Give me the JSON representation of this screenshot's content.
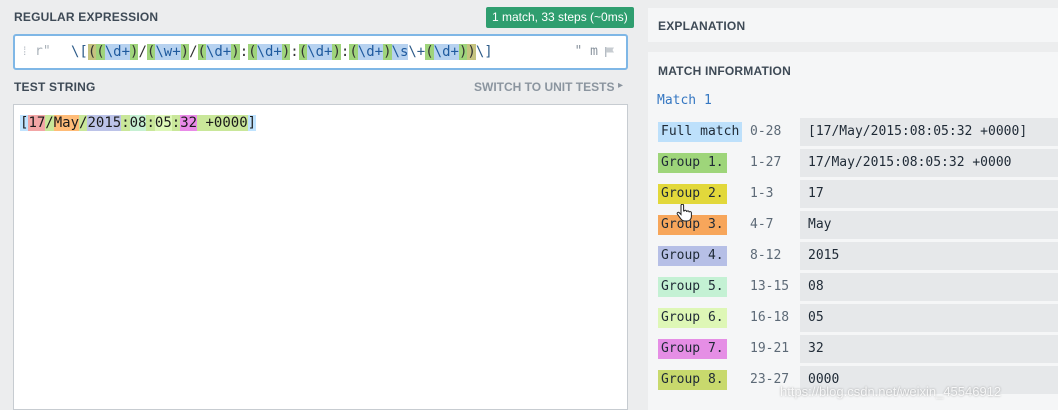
{
  "regex_section": {
    "label": "REGULAR EXPRESSION",
    "badge": "1 match, 33 steps (~0ms)",
    "prefix": "r\"",
    "pattern": "\\[((\\d+)/(\\w+)/(\\d+):(\\d+):(\\d+):(\\d+)\\s\\+(\\d+))\\]",
    "suffix": "\"",
    "flags": "m"
  },
  "test_section": {
    "label": "TEST STRING",
    "switch_label": "SWITCH TO UNIT TESTS",
    "text": "[17/May/2015:08:05:32 +0000]"
  },
  "explanation": {
    "label": "EXPLANATION"
  },
  "match_info": {
    "label": "MATCH INFORMATION",
    "match_label": "Match 1",
    "rows": [
      {
        "name": "Full match",
        "range": "0-28",
        "value": "[17/May/2015:08:05:32 +0000]",
        "color": "#bde0fb"
      },
      {
        "name": "Group 1.",
        "range": "1-27",
        "value": "17/May/2015:08:05:32 +0000",
        "color": "#9ed57a"
      },
      {
        "name": "Group 2.",
        "range": "1-3",
        "value": "17",
        "color": "#e2d83b"
      },
      {
        "name": "Group 3.",
        "range": "4-7",
        "value": "May",
        "color": "#f7a65b"
      },
      {
        "name": "Group 4.",
        "range": "8-12",
        "value": "2015",
        "color": "#b6bfe6"
      },
      {
        "name": "Group 5.",
        "range": "13-15",
        "value": "08",
        "color": "#c4f1d4"
      },
      {
        "name": "Group 6.",
        "range": "16-18",
        "value": "05",
        "color": "#def7b6"
      },
      {
        "name": "Group 7.",
        "range": "19-21",
        "value": "32",
        "color": "#e58ee5"
      },
      {
        "name": "Group 8.",
        "range": "23-27",
        "value": "0000",
        "color": "#c8d96d"
      }
    ]
  },
  "watermark": "https://blog.csdn.net/weixin_45546912"
}
